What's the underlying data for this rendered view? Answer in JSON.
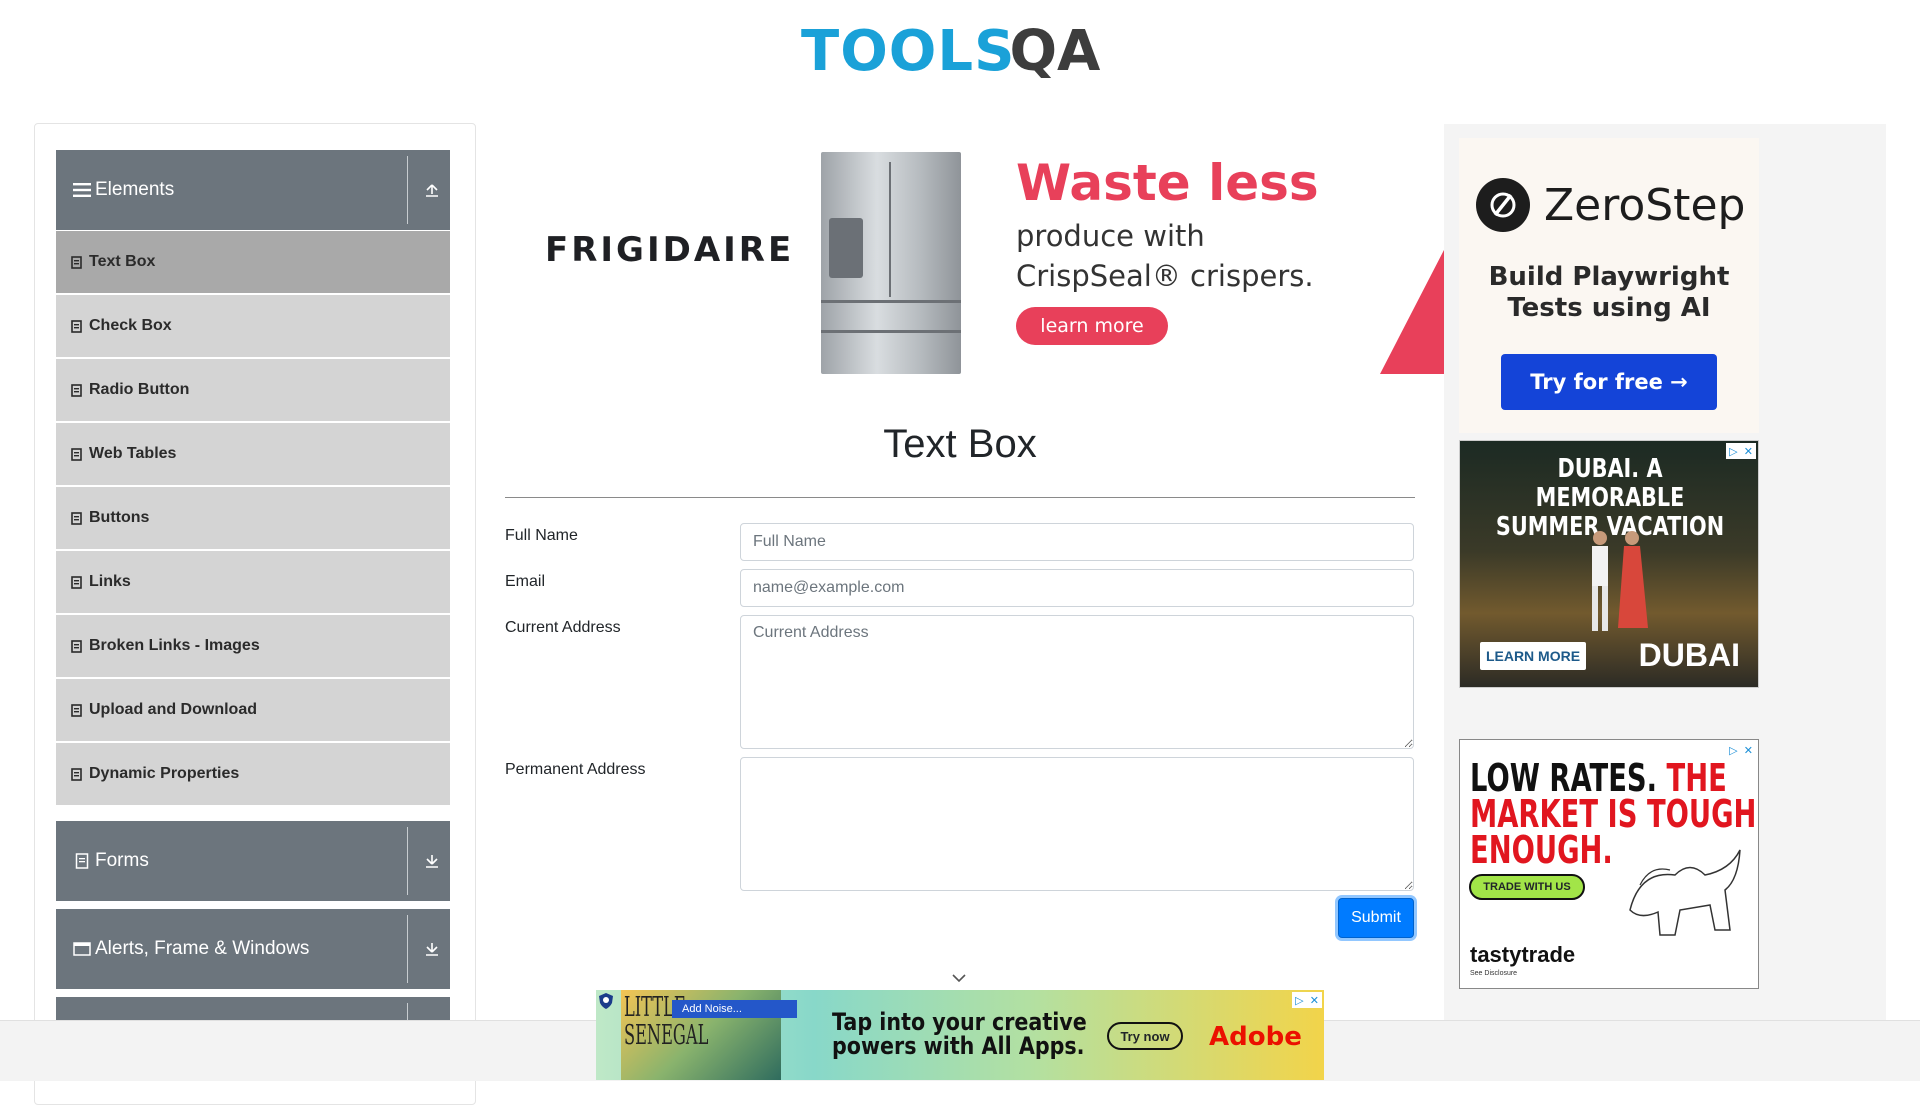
{
  "header": {
    "logo_part1": "TOOLS",
    "logo_part2": "QA"
  },
  "sidebar": {
    "groups": [
      {
        "label": "Elements",
        "icon": "hamburger-icon",
        "expanded": true
      },
      {
        "label": "Forms",
        "icon": "document-icon",
        "expanded": false
      },
      {
        "label": "Alerts, Frame & Windows",
        "icon": "window-icon",
        "expanded": false
      }
    ],
    "items": [
      {
        "label": "Text Box",
        "active": true
      },
      {
        "label": "Check Box"
      },
      {
        "label": "Radio Button"
      },
      {
        "label": "Web Tables"
      },
      {
        "label": "Buttons"
      },
      {
        "label": "Links"
      },
      {
        "label": "Broken Links - Images"
      },
      {
        "label": "Upload and Download"
      },
      {
        "label": "Dynamic Properties"
      }
    ]
  },
  "top_ad": {
    "brand": "FRIGIDAIRE",
    "headline": "Waste less",
    "line1": "produce with",
    "line2": "CrispSeal® crispers.",
    "cta": "learn more",
    "accent": "#e8405a"
  },
  "form": {
    "title": "Text Box",
    "full_name_label": "Full Name",
    "full_name_placeholder": "Full Name",
    "email_label": "Email",
    "email_placeholder": "name@example.com",
    "current_address_label": "Current Address",
    "current_address_placeholder": "Current Address",
    "permanent_address_label": "Permanent Address",
    "submit_label": "Submit",
    "submit_color": "#007bff"
  },
  "right_ads": {
    "zerostep": {
      "name": "ZeroStep",
      "text_line1": "Build Playwright",
      "text_line2": "Tests using AI",
      "cta": "Try for free →",
      "cta_color": "#1444d8"
    },
    "dubai": {
      "headline_line1": "DUBAI. A MEMORABLE",
      "headline_line2": "SUMMER VACATION",
      "cta": "LEARN MORE",
      "logo": "DUBAI"
    },
    "tasty": {
      "head_line1a": "LOW RATES. ",
      "head_line1b": "THE",
      "head_line2": "MARKET IS TOUGH",
      "head_line3": "ENOUGH.",
      "cta": "TRADE WITH US",
      "brand": "tastytrade",
      "disclosure": "See Disclosure"
    }
  },
  "bottom_ad": {
    "art_text_line1": "LITTLE",
    "art_text_line2": "SENEGAL",
    "noise_label": "Add Noise...",
    "text_line1": "Tap into your creative",
    "text_line2": "powers with All Apps.",
    "cta": "Try now",
    "brand": "Adobe"
  }
}
